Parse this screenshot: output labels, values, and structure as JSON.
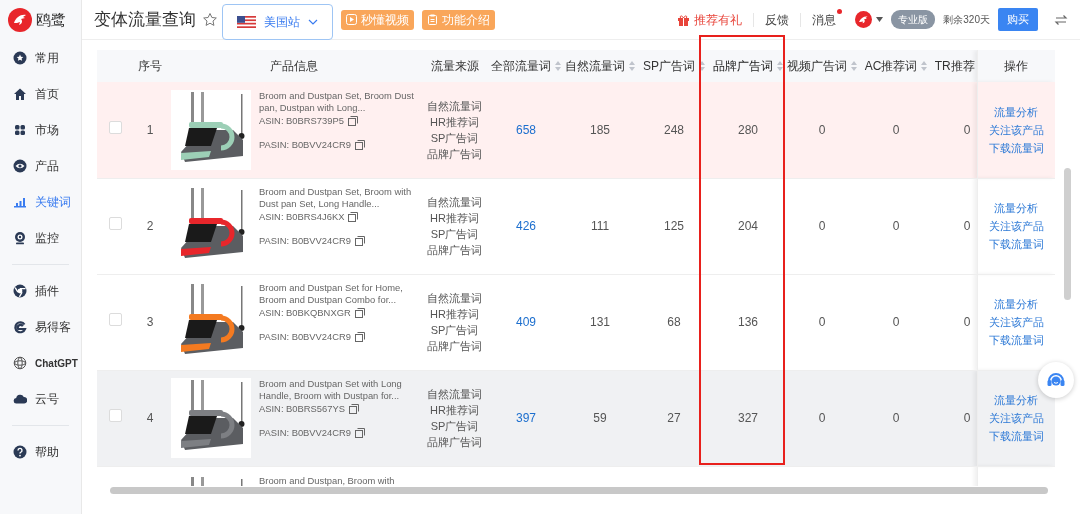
{
  "app": {
    "name": "鸥鹭"
  },
  "sidebar": {
    "groups": [
      {
        "items": [
          {
            "label": "常用",
            "selected": false
          },
          {
            "label": "首页",
            "selected": false
          },
          {
            "label": "市场",
            "selected": false
          },
          {
            "label": "产品",
            "selected": false
          },
          {
            "label": "关键词",
            "selected": true
          },
          {
            "label": "监控",
            "selected": false
          }
        ]
      },
      {
        "items": [
          {
            "label": "插件",
            "selected": false
          },
          {
            "label": "易得客",
            "selected": false
          },
          {
            "label": "ChatGPT",
            "selected": false
          },
          {
            "label": "云号",
            "selected": false
          }
        ]
      },
      {
        "items": [
          {
            "label": "帮助",
            "selected": false
          }
        ]
      }
    ]
  },
  "header": {
    "title": "变体流量查询",
    "site": "美国站",
    "buttons": [
      {
        "label": "秒懂视频"
      },
      {
        "label": "功能介绍"
      }
    ],
    "links": [
      {
        "label": "推荐有礼",
        "unread": false
      },
      {
        "label": "反馈",
        "unread": false
      },
      {
        "label": "消息",
        "unread": true
      }
    ],
    "plan": "专业版",
    "remaining": "剩余320天",
    "buy": "购买"
  },
  "table": {
    "columns": [
      {
        "label": "序号",
        "sortable": false,
        "highlighted": false
      },
      {
        "label": "产品信息",
        "sortable": false,
        "highlighted": false
      },
      {
        "label": "流量来源",
        "sortable": false,
        "highlighted": false
      },
      {
        "label": "全部流量词",
        "sortable": true,
        "highlighted": false
      },
      {
        "label": "自然流量词",
        "sortable": true,
        "highlighted": false
      },
      {
        "label": "SP广告词",
        "sortable": true,
        "highlighted": false
      },
      {
        "label": "品牌广告词",
        "sortable": true,
        "highlighted": true
      },
      {
        "label": "视频广告词",
        "sortable": true,
        "highlighted": false
      },
      {
        "label": "AC推荐词",
        "sortable": true,
        "highlighted": false
      },
      {
        "label": "TR推荐",
        "sortable": false,
        "highlighted": false
      },
      {
        "label": "操作",
        "sortable": false,
        "highlighted": false
      }
    ],
    "rows": [
      {
        "index": "1",
        "selected": true,
        "hovered": false,
        "checked": false,
        "color": "#9ccfb6",
        "title": "Broom and Dustpan Set, Broom Dust pan, Dustpan with Long...",
        "asin": "ASIN: B0BRS739P5",
        "pasin": "PASIN: B0BVV24CR9",
        "sources": [
          "自然流量词",
          "HR推荐词",
          "SP广告词",
          "品牌广告词"
        ],
        "values": [
          "658",
          "185",
          "248",
          "280",
          "0",
          "0",
          "0"
        ],
        "actions": [
          "流量分析",
          "关注该产品",
          "下载流量词"
        ]
      },
      {
        "index": "2",
        "selected": false,
        "hovered": false,
        "checked": false,
        "color": "#e8262b",
        "title": "Broom and Dustpan Set, Broom with Dust pan Set, Long Handle...",
        "asin": "ASIN: B0BRS4J6KX",
        "pasin": "PASIN: B0BVV24CR9",
        "sources": [
          "自然流量词",
          "HR推荐词",
          "SP广告词",
          "品牌广告词"
        ],
        "values": [
          "426",
          "111",
          "125",
          "204",
          "0",
          "0",
          "0"
        ],
        "actions": [
          "流量分析",
          "关注该产品",
          "下载流量词"
        ]
      },
      {
        "index": "3",
        "selected": false,
        "hovered": false,
        "checked": false,
        "color": "#f47a20",
        "title": "Broom and Dustpan Set for Home, Broom and Dustpan Combo for...",
        "asin": "ASIN: B0BKQBNXGR",
        "pasin": "PASIN: B0BVV24CR9",
        "sources": [
          "自然流量词",
          "HR推荐词",
          "SP广告词",
          "品牌广告词"
        ],
        "values": [
          "409",
          "131",
          "68",
          "136",
          "0",
          "0",
          "0"
        ],
        "actions": [
          "流量分析",
          "关注该产品",
          "下载流量词"
        ]
      },
      {
        "index": "4",
        "selected": false,
        "hovered": true,
        "checked": false,
        "color": "#7d7f83",
        "title": "Broom and Dustpan Set with Long Handle, Broom with Dustpan for...",
        "asin": "ASIN: B0BRS567YS",
        "pasin": "PASIN: B0BVV24CR9",
        "sources": [
          "自然流量词",
          "HR推荐词",
          "SP广告词",
          "品牌广告词"
        ],
        "values": [
          "397",
          "59",
          "27",
          "327",
          "0",
          "0",
          "0"
        ],
        "actions": [
          "流量分析",
          "关注该产品",
          "下载流量词"
        ]
      },
      {
        "selected": false,
        "hovered": false,
        "color": "#7d7f83",
        "title": "Broom and Dustpan, Broom with"
      }
    ]
  }
}
